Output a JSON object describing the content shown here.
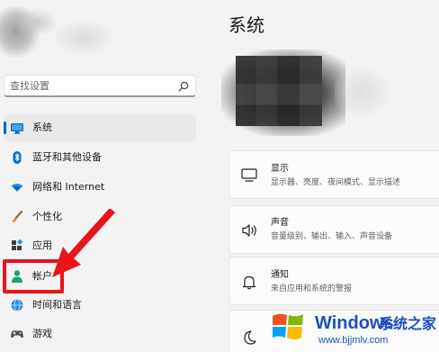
{
  "search": {
    "placeholder": "查找设置"
  },
  "sidebar": {
    "items": [
      {
        "label": "系统",
        "icon": "monitor-icon",
        "active": true
      },
      {
        "label": "蓝牙和其他设备",
        "icon": "bluetooth-icon"
      },
      {
        "label": "网络和 Internet",
        "icon": "wifi-icon"
      },
      {
        "label": "个性化",
        "icon": "brush-icon"
      },
      {
        "label": "应用",
        "icon": "apps-icon"
      },
      {
        "label": "帐户",
        "icon": "person-icon"
      },
      {
        "label": "时间和语言",
        "icon": "globe-clock-icon"
      },
      {
        "label": "游戏",
        "icon": "gamepad-icon"
      }
    ]
  },
  "main": {
    "title": "系统",
    "cards": [
      {
        "title": "显示",
        "subtitle": "显示器、亮度、夜间模式、显示描述",
        "icon": "display-icon"
      },
      {
        "title": "声音",
        "subtitle": "音量级别、输出、输入、声音设备",
        "icon": "speaker-icon"
      },
      {
        "title": "通知",
        "subtitle": "来自应用和系统的警报",
        "icon": "bell-icon"
      },
      {
        "title": "",
        "subtitle": "",
        "icon": "moon-icon"
      }
    ]
  },
  "watermark": {
    "brand": "Windows",
    "suffix": "系统之家",
    "url": "www.bjjmlv.com"
  },
  "colors": {
    "accent": "#0067c0",
    "highlight": "#e8141c",
    "watermark": "#1a4fbf"
  }
}
